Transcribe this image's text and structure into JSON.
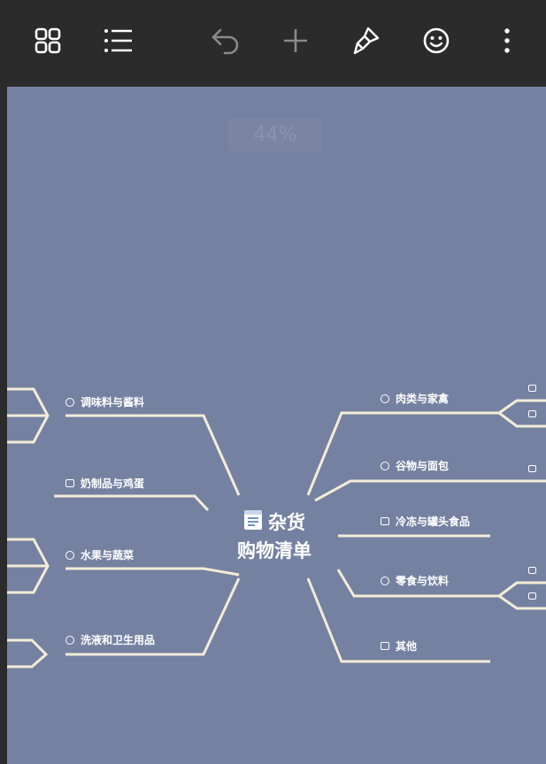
{
  "canvas": {
    "zoom": "44%",
    "background": "#7581a1",
    "line_color": "#f2ecd8"
  },
  "toolbar": {
    "icons": [
      "grid-view-icon",
      "outline-list-icon",
      "undo-icon",
      "add-icon",
      "paint-brush-icon",
      "emoji-icon",
      "more-vertical-icon"
    ]
  },
  "mindmap": {
    "center_line1": "杂货",
    "center_line2": "购物清单",
    "center_icon": "document-icon",
    "left": [
      {
        "label": "调味料与酱料",
        "marker": "circle"
      },
      {
        "label": "奶制品与鸡蛋",
        "marker": "square"
      },
      {
        "label": "水果与蔬菜",
        "marker": "circle"
      },
      {
        "label": "洗液和卫生用品",
        "marker": "circle"
      }
    ],
    "right": [
      {
        "label": "肉类与家禽",
        "marker": "circle"
      },
      {
        "label": "谷物与面包",
        "marker": "circle"
      },
      {
        "label": "冷冻与罐头食品",
        "marker": "square"
      },
      {
        "label": "零食与饮料",
        "marker": "circle"
      },
      {
        "label": "其他",
        "marker": "square"
      }
    ]
  }
}
